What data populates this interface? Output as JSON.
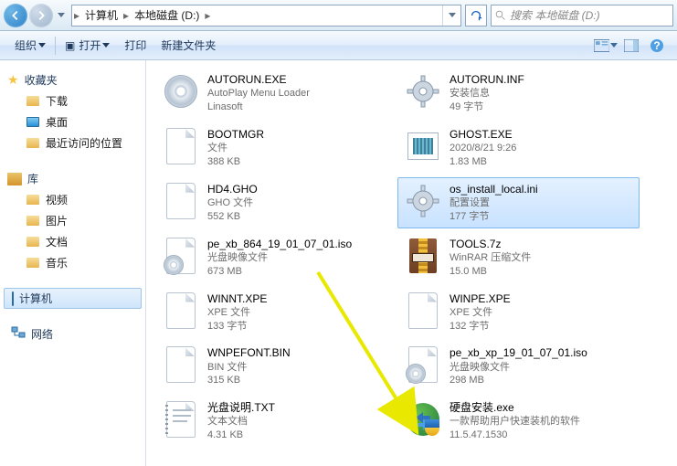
{
  "nav": {
    "crumbs": [
      "计算机",
      "本地磁盘 (D:)"
    ],
    "search_placeholder": "搜索 本地磁盘 (D:)"
  },
  "toolbar": {
    "organize": "组织",
    "open": "打开",
    "print": "打印",
    "newfolder": "新建文件夹"
  },
  "sidebar": {
    "favorites": {
      "label": "收藏夹",
      "items": [
        "下载",
        "桌面",
        "最近访问的位置"
      ]
    },
    "libraries": {
      "label": "库",
      "items": [
        "视频",
        "图片",
        "文档",
        "音乐"
      ]
    },
    "computer": "计算机",
    "network": "网络"
  },
  "files": [
    {
      "name": "AUTORUN.EXE",
      "type": "AutoPlay Menu Loader",
      "meta": "Linasoft",
      "icon": "disc"
    },
    {
      "name": "AUTORUN.INF",
      "type": "安装信息",
      "meta": "49 字节",
      "icon": "gear"
    },
    {
      "name": "BOOTMGR",
      "type": "文件",
      "meta": "388 KB",
      "icon": "doc"
    },
    {
      "name": "GHOST.EXE",
      "type": "2020/8/21 9:26",
      "meta": "1.83 MB",
      "icon": "ghost"
    },
    {
      "name": "HD4.GHO",
      "type": "GHO 文件",
      "meta": "552 KB",
      "icon": "doc"
    },
    {
      "name": "os_install_local.ini",
      "type": "配置设置",
      "meta": "177 字节",
      "icon": "gear",
      "selected": true
    },
    {
      "name": "pe_xb_864_19_01_07_01.iso",
      "type": "光盘映像文件",
      "meta": "673 MB",
      "icon": "disc-doc"
    },
    {
      "name": "TOOLS.7z",
      "type": "WinRAR 压缩文件",
      "meta": "15.0 MB",
      "icon": "rar"
    },
    {
      "name": "WINNT.XPE",
      "type": "XPE 文件",
      "meta": "133 字节",
      "icon": "doc"
    },
    {
      "name": "WINPE.XPE",
      "type": "XPE 文件",
      "meta": "132 字节",
      "icon": "doc"
    },
    {
      "name": "WNPEFONT.BIN",
      "type": "BIN 文件",
      "meta": "315 KB",
      "icon": "doc"
    },
    {
      "name": "pe_xb_xp_19_01_07_01.iso",
      "type": "光盘映像文件",
      "meta": "298 MB",
      "icon": "disc-doc"
    },
    {
      "name": "光盘说明.TXT",
      "type": "文本文档",
      "meta": "4.31 KB",
      "icon": "txt"
    },
    {
      "name": "硬盘安装.exe",
      "type": "一款帮助用户快速装机的软件",
      "meta": "11.5.47.1530",
      "icon": "hd"
    }
  ]
}
